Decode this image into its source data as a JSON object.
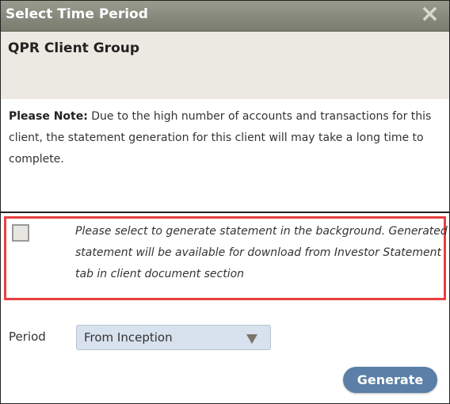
{
  "dialog": {
    "title": "Select Time Period",
    "close_icon": "×",
    "client_name": "QPR Client Group",
    "note_label": "Please Note:",
    "note_text": " Due to the high number of accounts and transactions for this client, the statement generation for this client will may take a long time to complete.",
    "background_option": {
      "checked": false,
      "text": "Please select to generate statement in the background. Generated statement will be available for download from Investor Statement tab in client document section"
    },
    "period": {
      "label": "Period",
      "selected": "From Inception"
    },
    "generate_label": "Generate"
  }
}
